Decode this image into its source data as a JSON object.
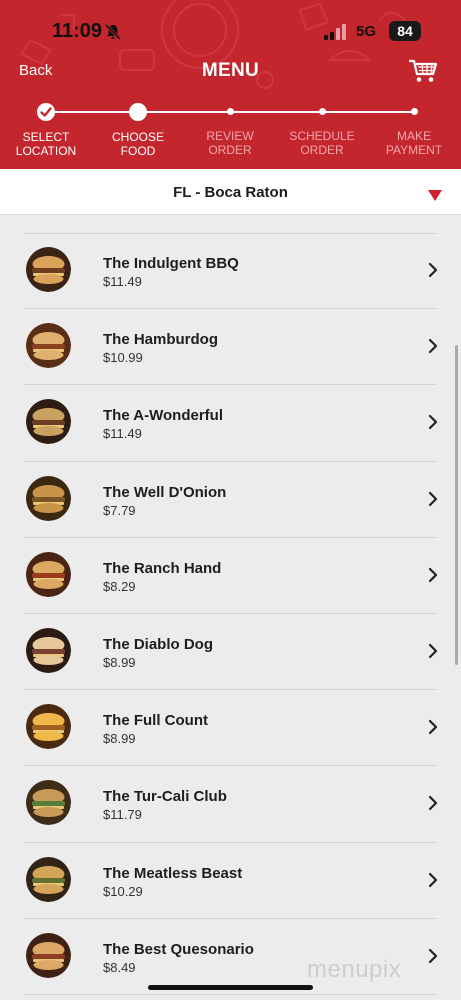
{
  "status_bar": {
    "time": "11:09",
    "network": "5G",
    "battery": "84"
  },
  "header": {
    "back_label": "Back",
    "title": "MENU",
    "accent_color": "#c4262e"
  },
  "stepper": {
    "steps": [
      {
        "label": "SELECT\nLOCATION",
        "state": "done"
      },
      {
        "label": "CHOOSE\nFOOD",
        "state": "current"
      },
      {
        "label": "REVIEW\nORDER",
        "state": "pending"
      },
      {
        "label": "SCHEDULE\nORDER",
        "state": "pending"
      },
      {
        "label": "MAKE\nPAYMENT",
        "state": "pending"
      }
    ]
  },
  "location": {
    "name": "FL - Boca Raton"
  },
  "menu": {
    "items": [
      {
        "name": "The Indulgent BBQ",
        "price": "$11.49"
      },
      {
        "name": "The Hamburdog",
        "price": "$10.99"
      },
      {
        "name": "The A-Wonderful",
        "price": "$11.49"
      },
      {
        "name": "The Well D'Onion",
        "price": "$7.79"
      },
      {
        "name": "The Ranch Hand",
        "price": "$8.29"
      },
      {
        "name": "The Diablo Dog",
        "price": "$8.99"
      },
      {
        "name": "The Full Count",
        "price": "$8.99"
      },
      {
        "name": "The Tur-Cali Club",
        "price": "$11.79"
      },
      {
        "name": "The Meatless Beast",
        "price": "$10.29"
      },
      {
        "name": "The Best Quesonario",
        "price": "$8.49"
      }
    ]
  },
  "watermark": "menupix"
}
